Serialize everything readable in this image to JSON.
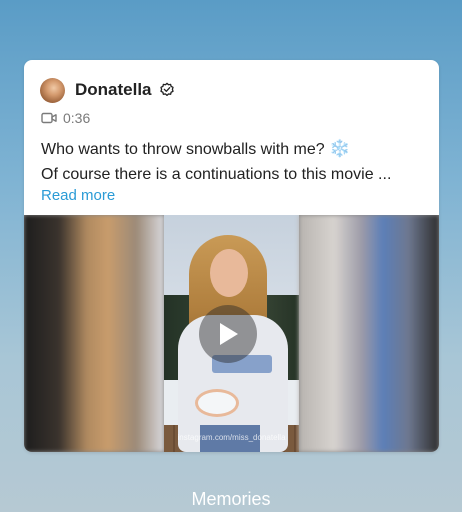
{
  "post": {
    "username": "Donatella",
    "duration": "0:36",
    "caption_line1": "Who wants to throw snowballs with me?",
    "caption_emoji": "❄️",
    "caption_line2": "Of course there is a continuations to this movie ...",
    "read_more": "Read more",
    "watermark": "instagram.com/miss_donatella"
  },
  "icons": {
    "verified": "verified-check-icon",
    "video": "video-camera-icon",
    "play": "play-icon"
  },
  "footer": {
    "label": "Memories"
  },
  "colors": {
    "link": "#2a9bd6",
    "card_bg": "#ffffff"
  }
}
